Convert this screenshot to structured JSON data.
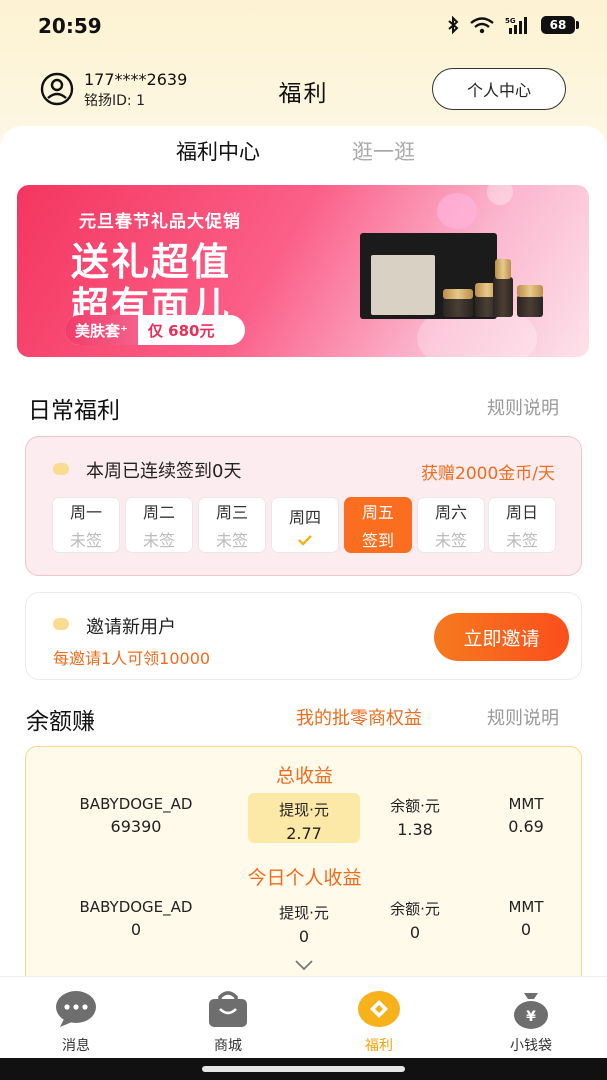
{
  "status_bar": {
    "time": "20:59",
    "battery": "68",
    "signal_label": "5G"
  },
  "header": {
    "phone": "177****2639",
    "user_id": "铭扬ID: 1",
    "title": "福利",
    "personal_center": "个人中心"
  },
  "tabs": [
    {
      "label": "福利中心",
      "active": true
    },
    {
      "label": "逛一逛",
      "active": false
    }
  ],
  "banner": {
    "subtitle": "元旦春节礼品大促销",
    "line1": "送礼超值",
    "line2": "超有面儿",
    "tag_left": "美肤套⁺",
    "tag_right": "仅 680元"
  },
  "daily": {
    "title": "日常福利",
    "rules": "规则说明",
    "signin_text": "本周已连续签到0天",
    "signin_reward": "获赠2000金币/天",
    "days": [
      {
        "name": "周一",
        "status": "未签"
      },
      {
        "name": "周二",
        "status": "未签"
      },
      {
        "name": "周三",
        "status": "未签"
      },
      {
        "name": "周四",
        "status": ""
      },
      {
        "name": "周五",
        "status": "签到"
      },
      {
        "name": "周六",
        "status": "未签"
      },
      {
        "name": "周日",
        "status": "未签"
      }
    ],
    "invite_title": "邀请新用户",
    "invite_sub": "每邀请1人可领10000",
    "invite_button": "立即邀请"
  },
  "balance": {
    "title": "余额赚",
    "wholesaler_link": "我的批零商权益",
    "rules": "规则说明",
    "total_heading": "总收益",
    "today_heading": "今日个人收益",
    "total": [
      {
        "label": "BABYDOGE_AD",
        "value": "69390"
      },
      {
        "label": "提现·元",
        "value": "2.77"
      },
      {
        "label": "余额·元",
        "value": "1.38"
      },
      {
        "label": "MMT",
        "value": "0.69"
      }
    ],
    "today": [
      {
        "label": "BABYDOGE_AD",
        "value": "0"
      },
      {
        "label": "提现·元",
        "value": "0"
      },
      {
        "label": "余额·元",
        "value": "0"
      },
      {
        "label": "MMT",
        "value": "0"
      }
    ]
  },
  "bottom_nav": [
    {
      "label": "消息",
      "icon": "message-icon",
      "active": false
    },
    {
      "label": "商城",
      "icon": "shop-bag-icon",
      "active": false
    },
    {
      "label": "福利",
      "icon": "welfare-icon",
      "active": true
    },
    {
      "label": "小钱袋",
      "icon": "money-bag-icon",
      "active": false
    }
  ],
  "colors": {
    "accent": "#ec6d1f",
    "active_nav": "#f4a10d",
    "banner_pink": "#f4365f"
  }
}
